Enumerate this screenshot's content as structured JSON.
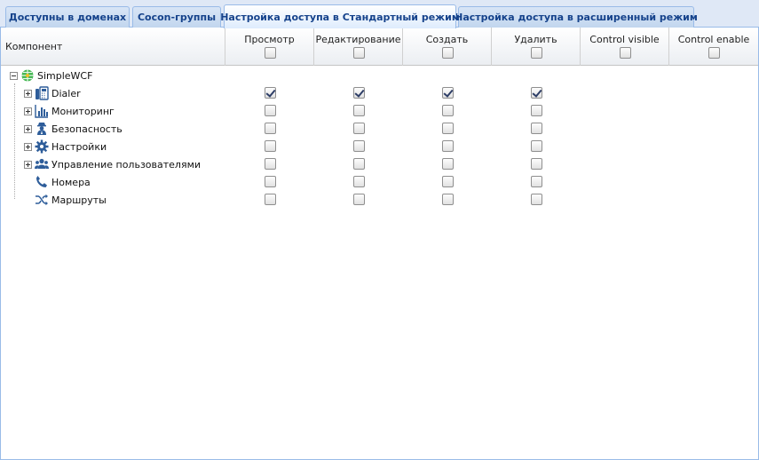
{
  "tabs": [
    {
      "label": "Доступны в доменах",
      "active": false
    },
    {
      "label": "Cocon-группы",
      "active": false
    },
    {
      "label": "Настройка доступа в Стандартный режим",
      "active": true
    },
    {
      "label": "Настройка доступа в расширенный режим",
      "active": false
    }
  ],
  "grid": {
    "columns": [
      {
        "label": "Компонент"
      },
      {
        "label": "Просмотр"
      },
      {
        "label": "Редактирование"
      },
      {
        "label": "Создать"
      },
      {
        "label": "Удалить"
      },
      {
        "label": "Control visible"
      },
      {
        "label": "Control enable"
      }
    ],
    "root": {
      "label": "SimpleWCF",
      "icon": "globe-icon",
      "expanded": true
    },
    "rows": [
      {
        "label": "Dialer",
        "icon": "phone-dialer-icon",
        "expandable": true,
        "checks": [
          true,
          true,
          true,
          true
        ]
      },
      {
        "label": "Мониторинг",
        "icon": "bar-chart-icon",
        "expandable": true,
        "checks": [
          false,
          false,
          false,
          false
        ]
      },
      {
        "label": "Безопасность",
        "icon": "security-agent-icon",
        "expandable": true,
        "checks": [
          false,
          false,
          false,
          false
        ]
      },
      {
        "label": "Настройки",
        "icon": "gear-icon",
        "expandable": true,
        "checks": [
          false,
          false,
          false,
          false
        ]
      },
      {
        "label": "Управление пользователями",
        "icon": "users-icon",
        "expandable": true,
        "checks": [
          false,
          false,
          false,
          false
        ]
      },
      {
        "label": "Номера",
        "icon": "phone-icon",
        "expandable": false,
        "checks": [
          false,
          false,
          false,
          false
        ]
      },
      {
        "label": "Маршруты",
        "icon": "shuffle-icon",
        "expandable": false,
        "checks": [
          false,
          false,
          false,
          false
        ]
      }
    ]
  },
  "colors": {
    "accent": "#15428b",
    "border": "#99bbe8",
    "tab_bg": "#dfe8f6"
  }
}
